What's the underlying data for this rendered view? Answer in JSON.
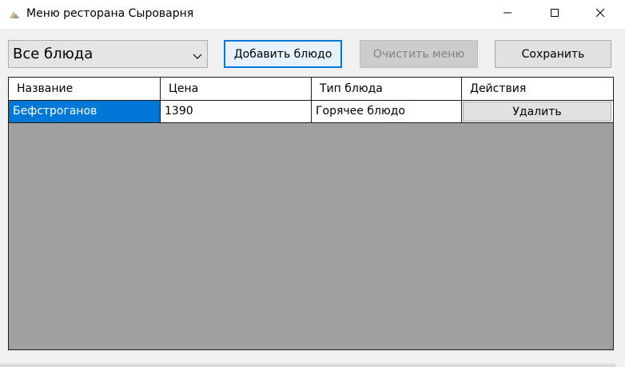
{
  "window": {
    "title": "Меню ресторана Сыроварня",
    "icon": "app-logo-icon",
    "controls": [
      "minimize-icon",
      "maximize-icon",
      "close-icon"
    ]
  },
  "filter": {
    "selected": "Все блюда"
  },
  "toolbar": {
    "add_label": "Добавить блюдо",
    "clear_label": "Очистить меню",
    "clear_enabled": false,
    "save_label": "Сохранить"
  },
  "table": {
    "columns": [
      "Название",
      "Цена",
      "Тип блюда",
      "Действия"
    ],
    "rows": [
      {
        "name": "Бефстроганов",
        "price": "1390",
        "type": "Горячее блюдо",
        "action": "Удалить"
      }
    ]
  },
  "colors": {
    "accent": "#0078d7",
    "grid_background": "#a0a0a0",
    "button_face": "#e1e1e1"
  }
}
